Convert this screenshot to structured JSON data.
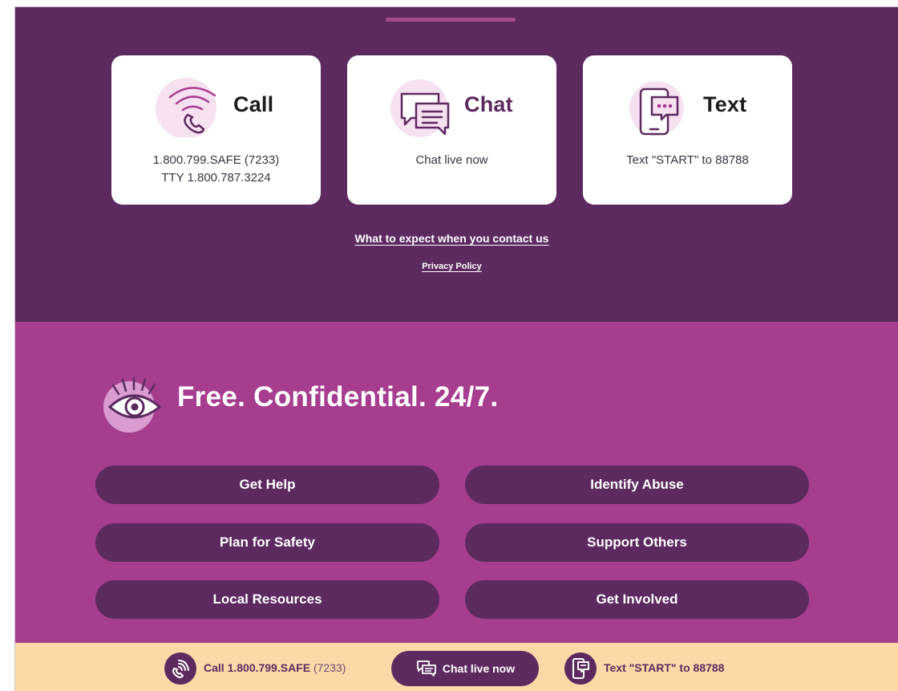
{
  "colors": {
    "deep_purple": "#5c2a5f",
    "magenta": "#a63d8f",
    "light_pink": "#f6e1f1",
    "bar_peach": "#fdd9a8",
    "white": "#ffffff"
  },
  "cards": {
    "call": {
      "icon": "phone-wifi-icon",
      "title": "Call",
      "line1": "1.800.799.SAFE (7233)",
      "line2": "TTY 1.800.787.3224"
    },
    "chat": {
      "icon": "chat-bubbles-icon",
      "title": "Chat",
      "line1": "Chat live now"
    },
    "text": {
      "icon": "mobile-message-icon",
      "title": "Text",
      "line1": "Text \"START\" to 88788"
    }
  },
  "links": {
    "expect": "What to expect when you contact us",
    "privacy": "Privacy Policy"
  },
  "mid": {
    "eye_icon": "eye-icon",
    "heading": "Free. Confidential. 24/7.",
    "nav": [
      {
        "label": "Get Help"
      },
      {
        "label": "Identify Abuse"
      },
      {
        "label": "Plan for Safety"
      },
      {
        "label": "Support Others"
      },
      {
        "label": "Local Resources"
      },
      {
        "label": "Get Involved"
      }
    ]
  },
  "bottom_bar": {
    "call_label": "Call 1.800.799.SAFE",
    "call_sub": "(7233)",
    "chat_label": "Chat live now",
    "text_label": "Text \"START\" to 88788"
  }
}
